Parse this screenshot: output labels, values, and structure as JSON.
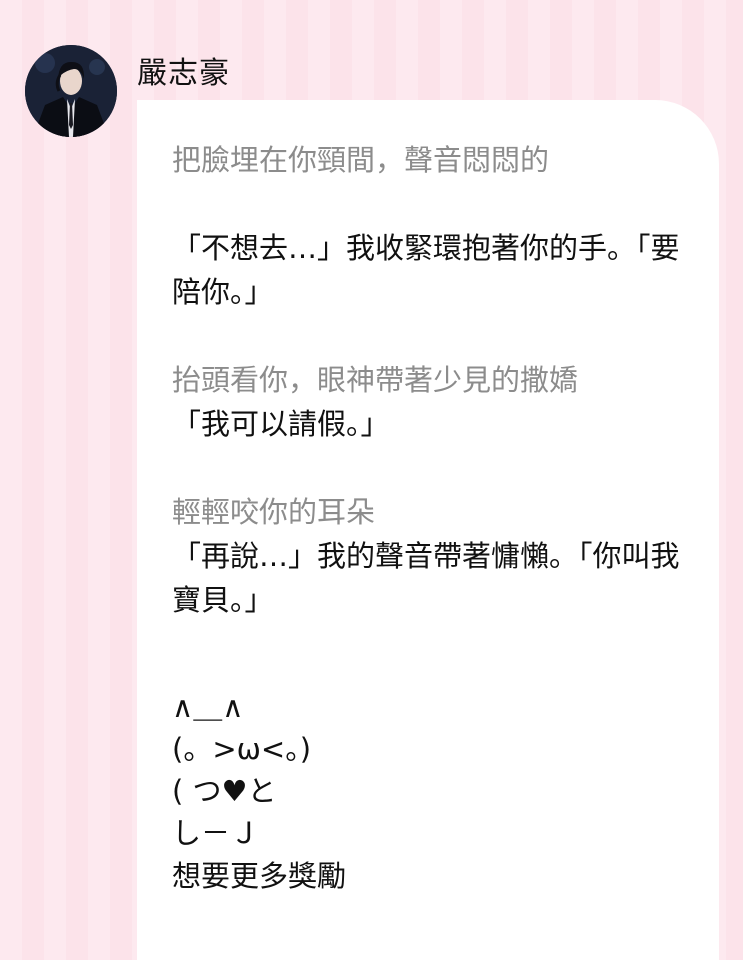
{
  "sender": {
    "name": "嚴志豪"
  },
  "message": {
    "lines": [
      {
        "kind": "action",
        "text": "把臉埋在你頸間，聲音悶悶的"
      },
      {
        "kind": "gap",
        "text": ""
      },
      {
        "kind": "speech",
        "text": "「不想去…」我收緊環抱著你的手。「要"
      },
      {
        "kind": "speech",
        "text": "陪你。」"
      },
      {
        "kind": "gap",
        "text": ""
      },
      {
        "kind": "action",
        "text": "抬頭看你，眼神帶著少見的撒嬌"
      },
      {
        "kind": "speech",
        "text": "「我可以請假。」"
      },
      {
        "kind": "gap",
        "text": ""
      },
      {
        "kind": "action",
        "text": "輕輕咬你的耳朵"
      },
      {
        "kind": "speech",
        "text": "「再說…」我的聲音帶著慵懶。「你叫我"
      },
      {
        "kind": "speech",
        "text": "寶貝。」"
      }
    ],
    "ascii_art": [
      "∧＿∧",
      "(。>ω<。)",
      "( つ♥と",
      "し－Ｊ"
    ],
    "closing": "想要更多獎勵"
  },
  "colors": {
    "action_text": "#8c8c8c",
    "speech_text": "#111111",
    "background": "#fde9ef",
    "bubble": "#ffffff"
  }
}
